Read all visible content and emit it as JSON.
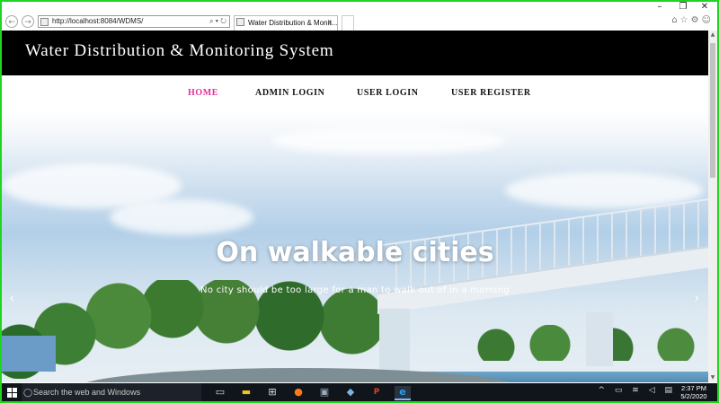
{
  "browser": {
    "address_url": "http://localhost:8084/WDMS/",
    "tab_title": "Water Distribution & Monit...",
    "tab_close": "×",
    "address_tools": "⌕ ▾ ↻",
    "window_buttons": {
      "minimize": "–",
      "restore": "❐",
      "close": "✕"
    },
    "right_icons": "⌂☆⚙☺"
  },
  "site": {
    "title": "Water Distribution & Monitoring System",
    "menu": [
      {
        "label": "HOME",
        "active": true
      },
      {
        "label": "ADMIN LOGIN",
        "active": false
      },
      {
        "label": "USER LOGIN",
        "active": false
      },
      {
        "label": "USER REGISTER",
        "active": false
      }
    ],
    "accent_color": "#e0309a"
  },
  "hero": {
    "heading": "On walkable cities",
    "subtitle": "No city should be too large for a man to walk out of in a morning",
    "prev_icon": "‹",
    "next_icon": "›"
  },
  "taskbar": {
    "search_placeholder": "Search the web and Windows",
    "clock_time": "2:37 PM",
    "clock_date": "5/2/2020",
    "icons": [
      "task-view-icon",
      "file-explorer-icon",
      "store-icon",
      "firefox-icon",
      "app-icon",
      "package-icon",
      "powerpoint-icon",
      "internet-explorer-icon"
    ]
  }
}
